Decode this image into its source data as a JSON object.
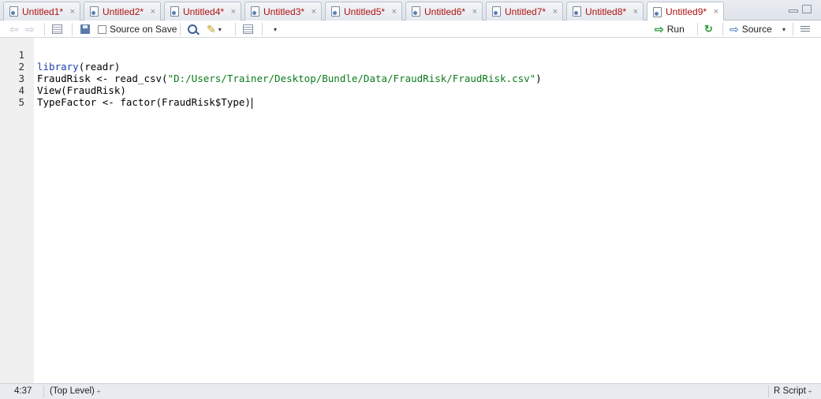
{
  "tabs": [
    {
      "label": "Untitled1*",
      "close": "×"
    },
    {
      "label": "Untitled2*",
      "close": "×"
    },
    {
      "label": "Untitled4*",
      "close": "×"
    },
    {
      "label": "Untitled3*",
      "close": "×"
    },
    {
      "label": "Untitled5*",
      "close": "×"
    },
    {
      "label": "Untitled6*",
      "close": "×"
    },
    {
      "label": "Untitled7*",
      "close": "×"
    },
    {
      "label": "Untitled8*",
      "close": "×"
    },
    {
      "label": "Untitled9*",
      "close": "×"
    }
  ],
  "active_tab": "Untitled9*",
  "toolbar": {
    "back_icon": "⇦",
    "forward_icon": "⇨",
    "wand_icon": "✎",
    "caret": "▾",
    "source_on_save_label": "Source on Save",
    "source_on_save_checked": false,
    "run_icon": "⇨",
    "run_label": "Run",
    "rerun_icon": "↻",
    "source_icon": "⇨",
    "source_label": "Source",
    "source_caret": "▾"
  },
  "editor": {
    "lines": [
      {
        "num": "1",
        "tokens": [
          {
            "t": "library",
            "c": "kw"
          },
          {
            "t": "(readr)",
            "c": ""
          }
        ]
      },
      {
        "num": "2",
        "tokens": [
          {
            "t": "FraudRisk <- read_csv(",
            "c": ""
          },
          {
            "t": "\"D:/Users/Trainer/Desktop/Bundle/Data/FraudRisk/FraudRisk.csv\"",
            "c": "str"
          },
          {
            "t": ")",
            "c": ""
          }
        ]
      },
      {
        "num": "3",
        "tokens": [
          {
            "t": "View(FraudRisk)",
            "c": ""
          }
        ]
      },
      {
        "num": "4",
        "tokens": [
          {
            "t": "TypeFactor <- factor(FraudRisk$Type)",
            "c": ""
          }
        ]
      },
      {
        "num": "5",
        "tokens": []
      }
    ]
  },
  "status": {
    "cursor_position": "4:37",
    "scope": "(Top Level)",
    "scope_arrows": "÷",
    "file_type": "R Script",
    "file_type_arrows": "÷"
  },
  "colors": {
    "keyword": "#1f3fb0",
    "string": "#0b7a1b",
    "tab_text": "#b01010"
  }
}
